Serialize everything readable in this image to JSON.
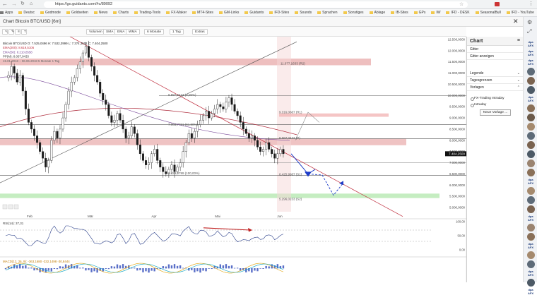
{
  "browser": {
    "url": "https://go.guidants.com/#c/89092",
    "bookmarks": [
      "Apps",
      "Deutsc",
      "Godmode",
      "Goldseiten",
      "News",
      "Charts",
      "Trading-Tools",
      "FX-Maker",
      "MT4-Sites",
      "GM-Links",
      "Guidants",
      "IFD-Sites",
      "Sounds",
      "Sprachen",
      "Sonstiges",
      "Ablage",
      "IB-Sites",
      "GPs",
      "IW",
      "IFD - DESK",
      "SeasonalBull",
      "IFD - YouTube"
    ]
  },
  "window": {
    "title": "Chart Bitcoin BTC/USD [6m]"
  },
  "toolbar": {
    "items": [
      "Volumen",
      "SMA",
      "EMA",
      "WMA",
      "6 Monate",
      "1 Tag",
      "Extras"
    ]
  },
  "legend": {
    "ohlc": "Bitcoin BTC/USD  O: 7.525,0496  H: 7.532,3999  L: 7.374,3501  C: 7.404,2500",
    "ema200": "EMA(200): 8.619,5106",
    "ema50": "EMA(50): 8.210,8558",
    "pp": "PP(M): 8.067,0433",
    "range": "15.01.2018 – 06.06.2018",
    "period": "5 Monate  1 Tag"
  },
  "fib_labels": [
    "11.677,1633 (R2)",
    "9.316,0887 (R1)",
    "8.067,0433 (P)",
    "6.425,9987 (S1)",
    "5.296,0233 (S2)",
    "9.987,5434 (0,00%)",
    "7.003,7791 (61,80%)",
    "6.429,0789 (100,00%)"
  ],
  "price_axis": [
    "12.500,0000",
    "12.000,0000",
    "11.500,0000",
    "11.000,0000",
    "10.500,0000",
    "10.000,0000",
    "9.500,0000",
    "9.000,0000",
    "8.500,0000",
    "8.000,0000",
    "7.500,0000",
    "7.000,0000",
    "6.500,0000",
    "6.000,0000",
    "5.500,0000",
    "5.000,0000"
  ],
  "current_price": "7.404,2500",
  "time_axis": [
    "Feb",
    "Mär",
    "Apr",
    "Mai",
    "Jun"
  ],
  "rsi": {
    "label": "RSI(14): 37,31",
    "ticks": [
      "100,00",
      "50,00",
      "0,00"
    ]
  },
  "macd": {
    "label": "MACD(12, 26, 9): -363,1680  -332,1498  -30,8444"
  },
  "colors": {
    "candle_up": "#ffffff",
    "candle_down": "#1a1a1a",
    "red_zone": "#e8a9a9",
    "green_zone": "#b7e9b2",
    "arrow": "#1e3cc8"
  },
  "panel": {
    "title": "Chart",
    "sections": [
      {
        "label": "Gitter",
        "rows": [
          "Gitter anzeigen"
        ]
      },
      {
        "label": "Legende",
        "rows": []
      },
      {
        "label": "Tagesgrenzen",
        "rows": []
      },
      {
        "label": "Vorlagen",
        "rows": [
          "FX-Trading Intraday",
          "Intraday"
        ]
      }
    ],
    "button": "Neue Vorlage ..."
  }
}
